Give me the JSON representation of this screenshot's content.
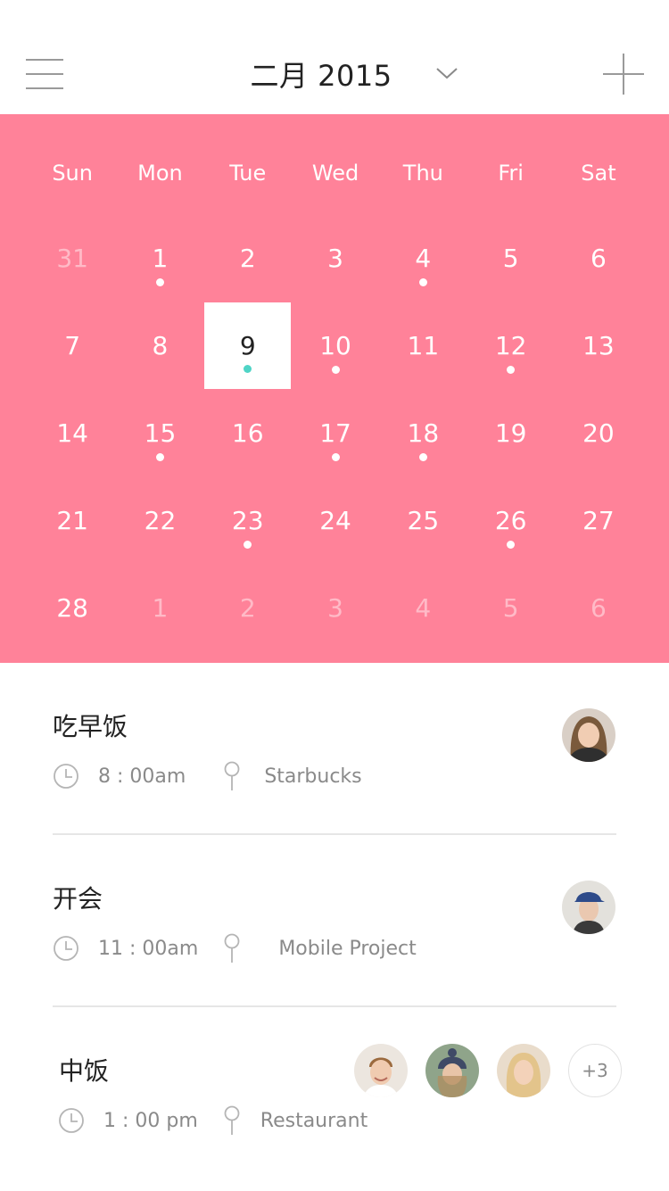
{
  "header": {
    "title": "二月 2015"
  },
  "calendar": {
    "weekdays": [
      "Sun",
      "Mon",
      "Tue",
      "Wed",
      "Thu",
      "Fri",
      "Sat"
    ],
    "days": [
      {
        "label": "31",
        "muted": true,
        "dot": false
      },
      {
        "label": "1",
        "muted": false,
        "dot": true
      },
      {
        "label": "2",
        "muted": false,
        "dot": false
      },
      {
        "label": "3",
        "muted": false,
        "dot": false
      },
      {
        "label": "4",
        "muted": false,
        "dot": true
      },
      {
        "label": "5",
        "muted": false,
        "dot": false
      },
      {
        "label": "6",
        "muted": false,
        "dot": false
      },
      {
        "label": "7",
        "muted": false,
        "dot": false
      },
      {
        "label": "8",
        "muted": false,
        "dot": false
      },
      {
        "label": "9",
        "muted": false,
        "dot": true,
        "selected": true
      },
      {
        "label": "10",
        "muted": false,
        "dot": true
      },
      {
        "label": "11",
        "muted": false,
        "dot": false
      },
      {
        "label": "12",
        "muted": false,
        "dot": true
      },
      {
        "label": "13",
        "muted": false,
        "dot": false
      },
      {
        "label": "14",
        "muted": false,
        "dot": false
      },
      {
        "label": "15",
        "muted": false,
        "dot": true
      },
      {
        "label": "16",
        "muted": false,
        "dot": false
      },
      {
        "label": "17",
        "muted": false,
        "dot": true
      },
      {
        "label": "18",
        "muted": false,
        "dot": true
      },
      {
        "label": "19",
        "muted": false,
        "dot": false
      },
      {
        "label": "20",
        "muted": false,
        "dot": false
      },
      {
        "label": "21",
        "muted": false,
        "dot": false
      },
      {
        "label": "22",
        "muted": false,
        "dot": false
      },
      {
        "label": "23",
        "muted": false,
        "dot": true
      },
      {
        "label": "24",
        "muted": false,
        "dot": false
      },
      {
        "label": "25",
        "muted": false,
        "dot": false
      },
      {
        "label": "26",
        "muted": false,
        "dot": true
      },
      {
        "label": "27",
        "muted": false,
        "dot": false
      },
      {
        "label": "28",
        "muted": false,
        "dot": false
      },
      {
        "label": "1",
        "muted": true,
        "dot": false
      },
      {
        "label": "2",
        "muted": true,
        "dot": false
      },
      {
        "label": "3",
        "muted": true,
        "dot": false
      },
      {
        "label": "4",
        "muted": true,
        "dot": false
      },
      {
        "label": "5",
        "muted": true,
        "dot": false
      },
      {
        "label": "6",
        "muted": true,
        "dot": false
      }
    ],
    "colors": {
      "background": "#ff8299",
      "selected_dot": "#4fd4c6"
    }
  },
  "events": [
    {
      "title": "吃早饭",
      "time": "8 : 00am",
      "location": "Starbucks",
      "avatars": [
        "avatar-woman-blonde"
      ]
    },
    {
      "title": "开会",
      "time": "11 : 00am",
      "location": "Mobile Project",
      "avatars": [
        "avatar-man-cap"
      ]
    },
    {
      "title": "中饭",
      "time": "1 : 00 pm",
      "location": "Restaurant",
      "avatars": [
        "avatar-man-smiling",
        "avatar-woman-beanie",
        "avatar-woman-blonde-2"
      ],
      "more": "+3"
    }
  ],
  "icons": {
    "menu": "hamburger-menu-icon",
    "dropdown": "chevron-down-icon",
    "add": "plus-icon",
    "time": "clock-icon",
    "location": "map-pin-icon"
  }
}
